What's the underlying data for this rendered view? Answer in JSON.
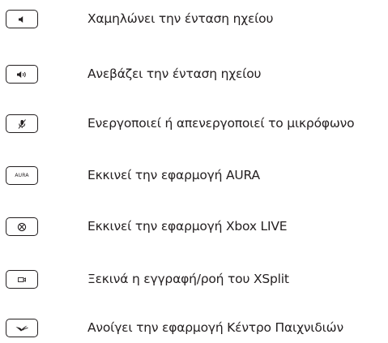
{
  "hotkeys": [
    {
      "icon": "volume-down-icon",
      "description": "Χαμηλώνει την ένταση ηχείου"
    },
    {
      "icon": "volume-up-icon",
      "description": "Ανεβάζει την ένταση ηχείου"
    },
    {
      "icon": "microphone-mute-icon",
      "description": "Ενεργοποιεί ή απενεργοποιεί το μικρόφωνο"
    },
    {
      "icon": "aura-icon",
      "key_label": "AURA",
      "description": "Εκκινεί την εφαρμογή AURA"
    },
    {
      "icon": "xbox-icon",
      "description": "Εκκινεί την εφαρμογή Xbox LIVE"
    },
    {
      "icon": "xsplit-record-icon",
      "description": "Ξεκινά η εγγραφή/ροή του XSplit"
    },
    {
      "icon": "rog-gaming-center-icon",
      "description": "Ανοίγει την εφαρμογή Κέντρο Παιχνιδιών"
    }
  ]
}
